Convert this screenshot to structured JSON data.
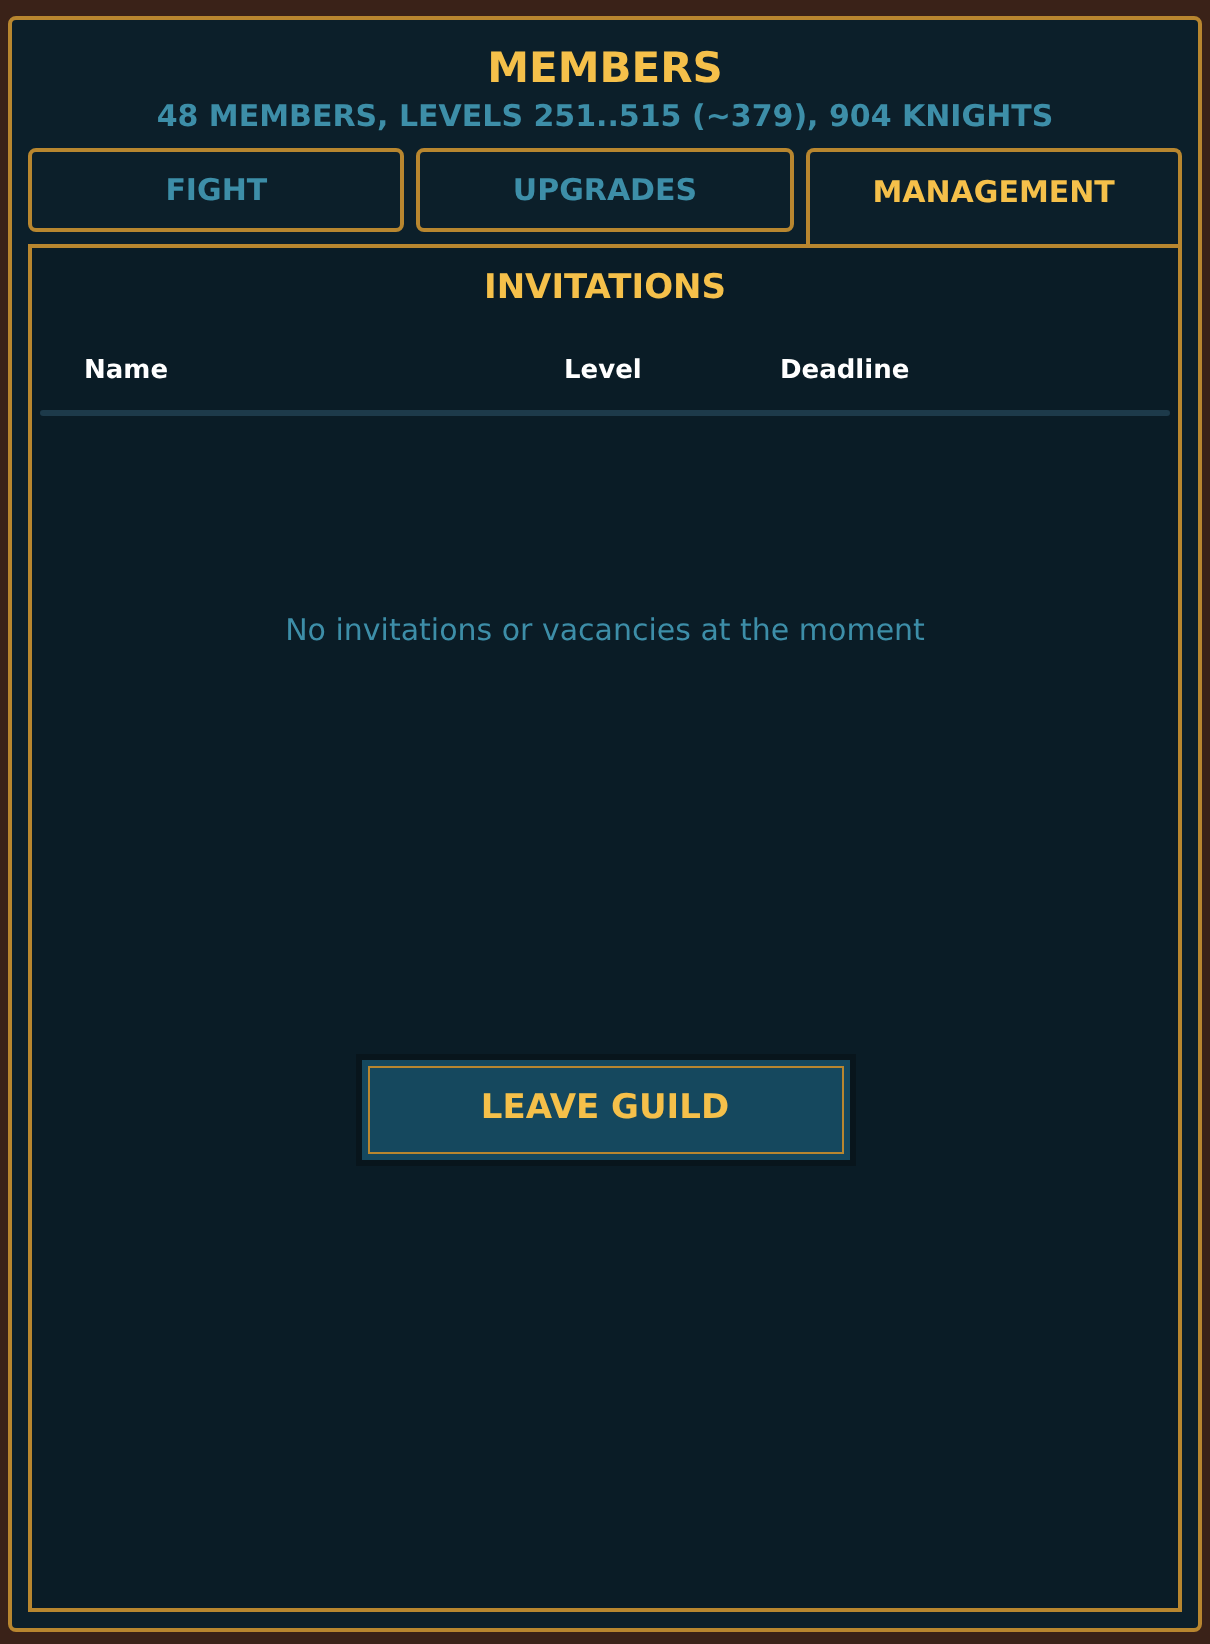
{
  "header": {
    "title": "MEMBERS",
    "subtitle": "48 MEMBERS, LEVELS 251..515 (~379), 904 KNIGHTS"
  },
  "tabs": [
    {
      "label": "FIGHT",
      "selected": false
    },
    {
      "label": "UPGRADES",
      "selected": false
    },
    {
      "label": "MANAGEMENT",
      "selected": true
    }
  ],
  "section": {
    "title": "INVITATIONS",
    "columns": [
      "Name",
      "Level",
      "Deadline"
    ],
    "empty_message": "No invitations or vacancies at the moment"
  },
  "leave_button": "LEAVE GUILD"
}
